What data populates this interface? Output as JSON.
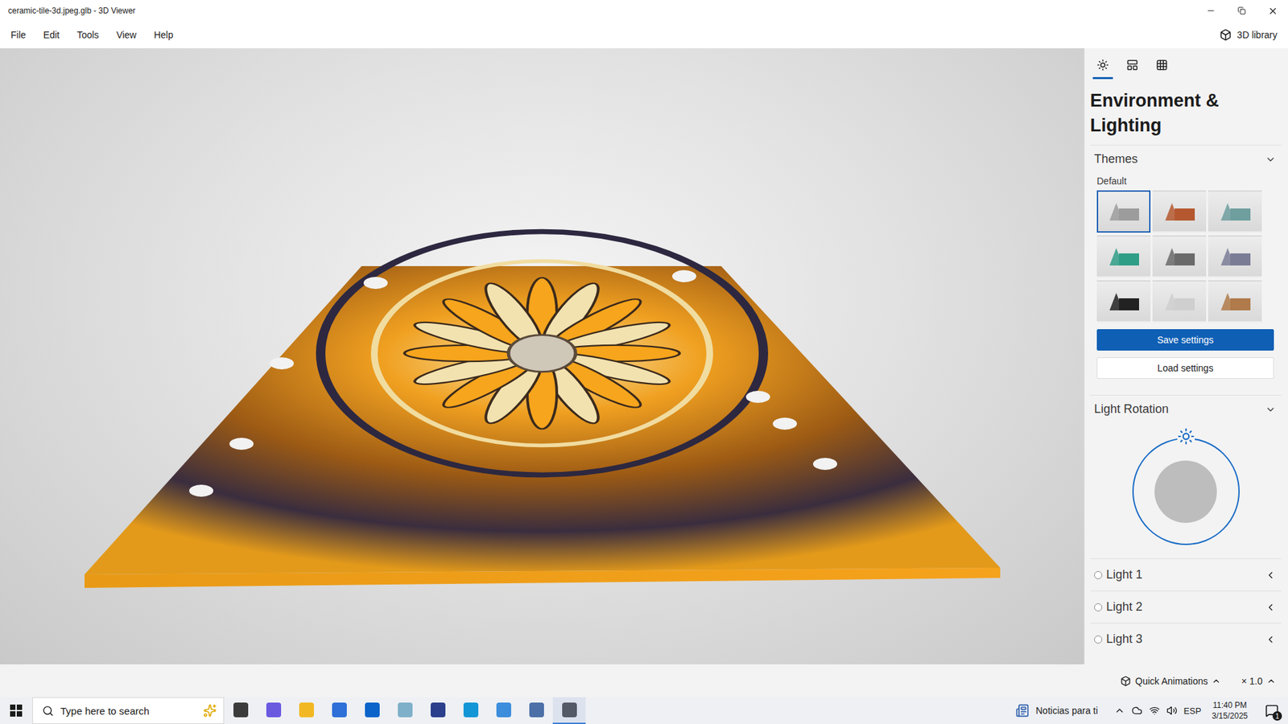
{
  "window": {
    "title": "ceramic-tile-3d.jpeg.glb - 3D Viewer"
  },
  "menu": [
    "File",
    "Edit",
    "Tools",
    "View",
    "Help"
  ],
  "library_button": "3D library",
  "panel_tabs": [
    {
      "kind": "lighting",
      "selected": true
    },
    {
      "kind": "stats",
      "selected": false
    },
    {
      "kind": "grid",
      "selected": false
    }
  ],
  "panel": {
    "title": "Environment & Lighting",
    "themes": {
      "label": "Themes",
      "expanded": true,
      "group": "Default",
      "items": [
        {
          "selected": true,
          "color": "#9c9c9c"
        },
        {
          "selected": false,
          "color": "#b5582f"
        },
        {
          "selected": false,
          "color": "#6f9e9e"
        },
        {
          "selected": false,
          "color": "#2f9e86"
        },
        {
          "selected": false,
          "color": "#6a6a6a"
        },
        {
          "selected": false,
          "color": "#7a7c96"
        },
        {
          "selected": false,
          "color": "#222222"
        },
        {
          "selected": false,
          "color": "#cfcfcf"
        },
        {
          "selected": false,
          "color": "#b07a4a"
        }
      ]
    },
    "buttons": [
      {
        "label": "Save settings",
        "kind": "primary"
      },
      {
        "label": "Load settings",
        "kind": "secondary"
      }
    ],
    "light_rotation": {
      "label": "Light Rotation",
      "expanded": true
    },
    "lights": [
      {
        "label": "Light 1",
        "checked": false,
        "expanded": false
      },
      {
        "label": "Light 2",
        "checked": false,
        "expanded": false
      },
      {
        "label": "Light 3",
        "checked": false,
        "expanded": false
      }
    ]
  },
  "status_bar": {
    "quick_animations": "Quick Animations",
    "speed": "× 1.0"
  },
  "taskbar": {
    "search_placeholder": "Type here to search",
    "apps": [
      {
        "kind": "taskview",
        "selected": false
      },
      {
        "kind": "copilot",
        "selected": false
      },
      {
        "kind": "explorer",
        "selected": false
      },
      {
        "kind": "store",
        "selected": false
      },
      {
        "kind": "outlook",
        "selected": false
      },
      {
        "kind": "notes",
        "selected": false
      },
      {
        "kind": "terminal",
        "selected": false
      },
      {
        "kind": "edge",
        "selected": false
      },
      {
        "kind": "remote",
        "selected": false
      },
      {
        "kind": "monitor",
        "selected": false
      },
      {
        "kind": "viewer3d",
        "selected": true
      }
    ],
    "news": "Noticias para ti",
    "language": "ESP",
    "time": "11:40 PM",
    "date": "3/15/2025",
    "notifications": "1"
  }
}
